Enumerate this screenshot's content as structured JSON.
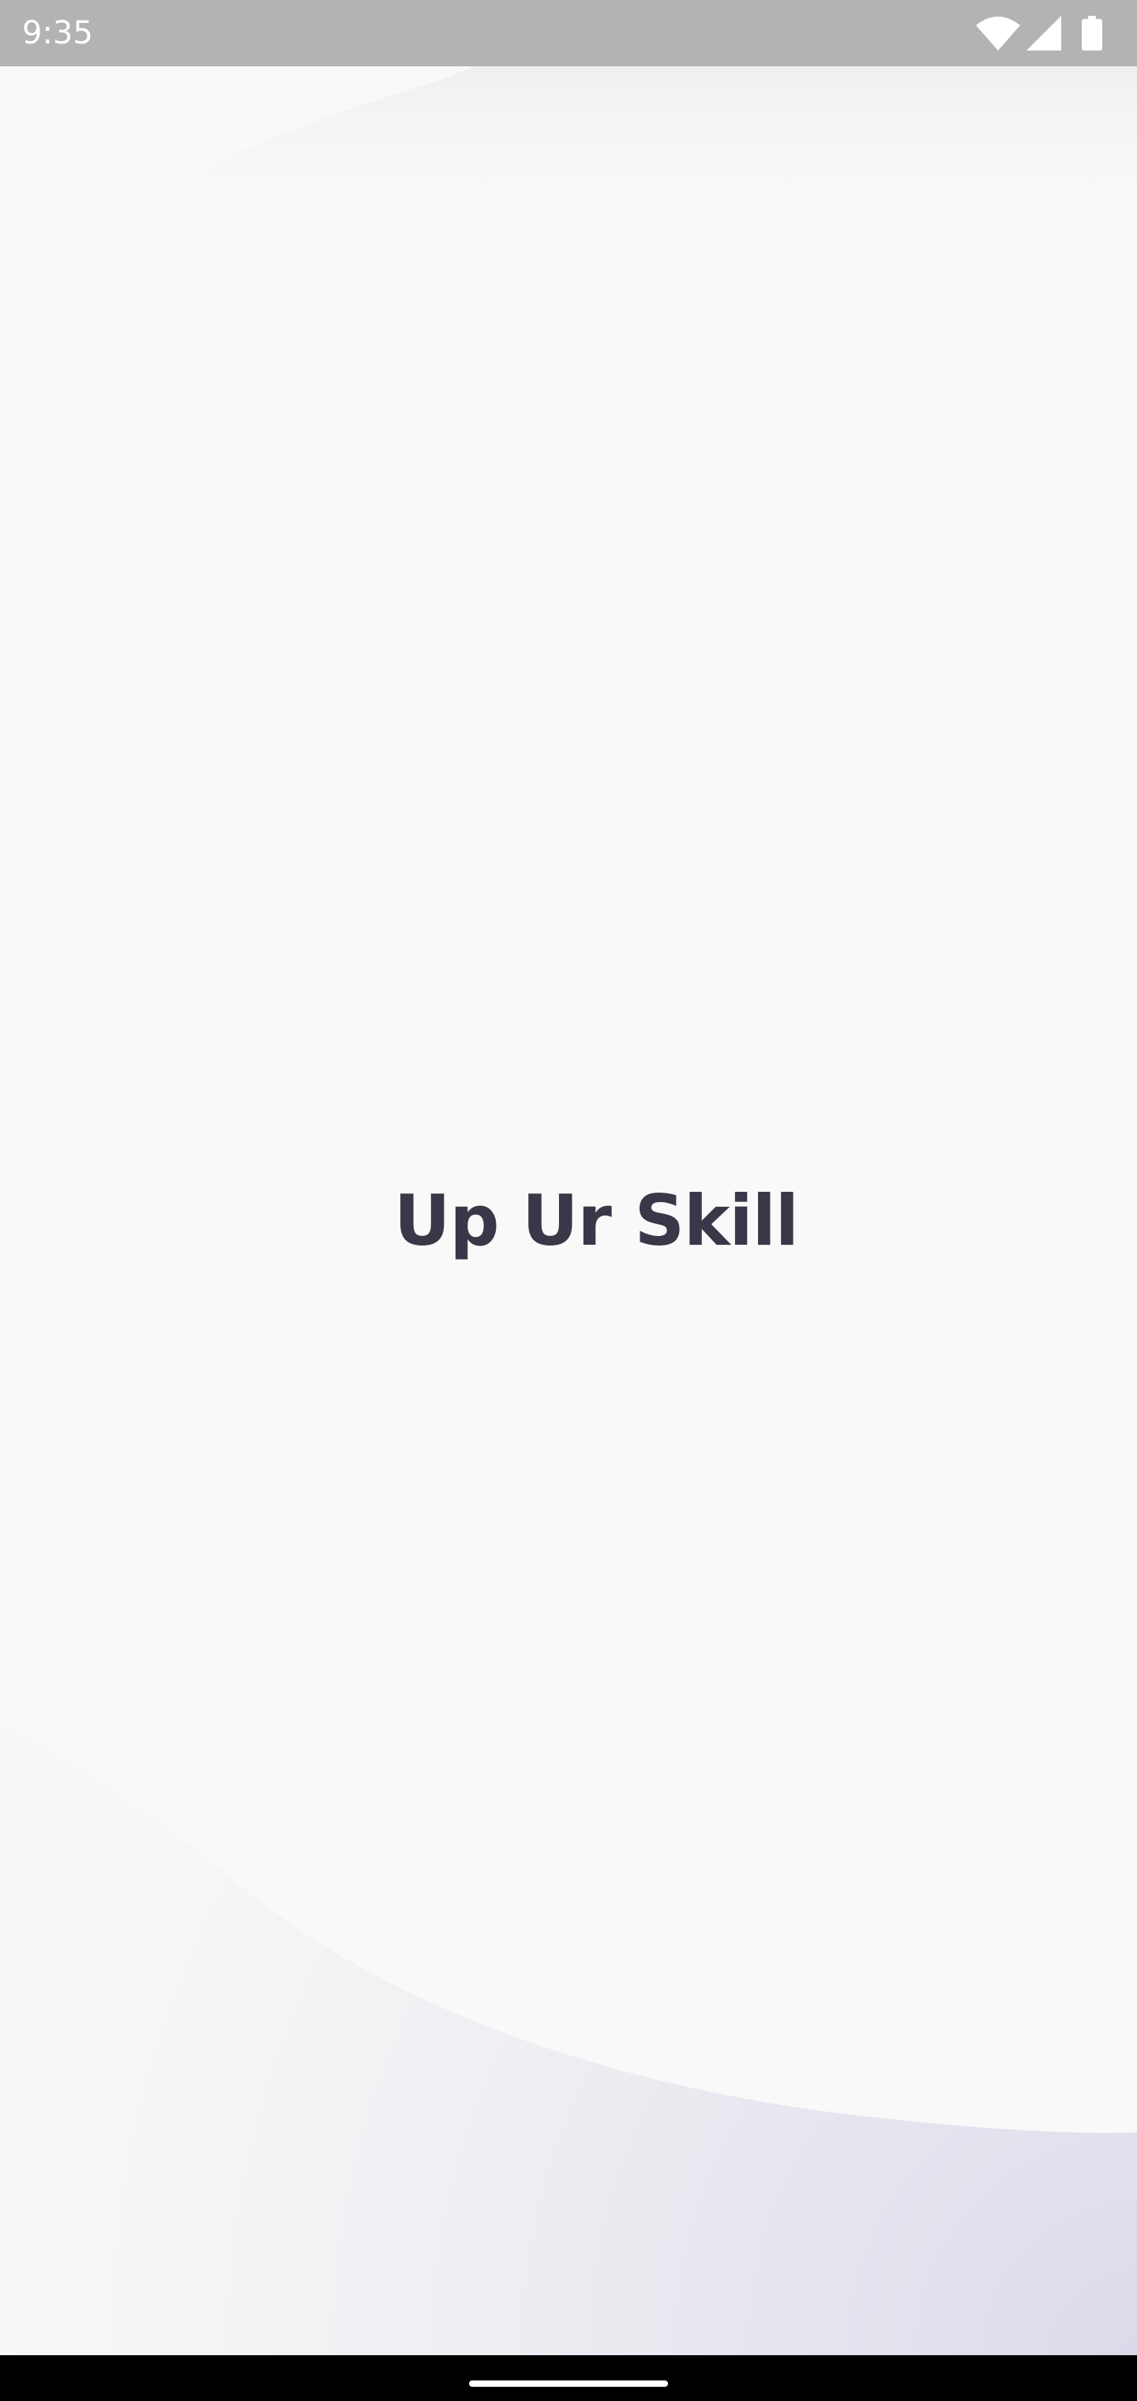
{
  "status_bar": {
    "time": "9:35",
    "icons": [
      "wifi-icon",
      "cellular-signal-icon",
      "battery-icon"
    ]
  },
  "splash": {
    "title": "Up Ur Skill"
  },
  "colors": {
    "background": "#f9f9f9",
    "title": "#393848",
    "status_bar": "#b3b3b3",
    "wave_accent": "#dcdaea",
    "nav_bar": "#000000"
  }
}
